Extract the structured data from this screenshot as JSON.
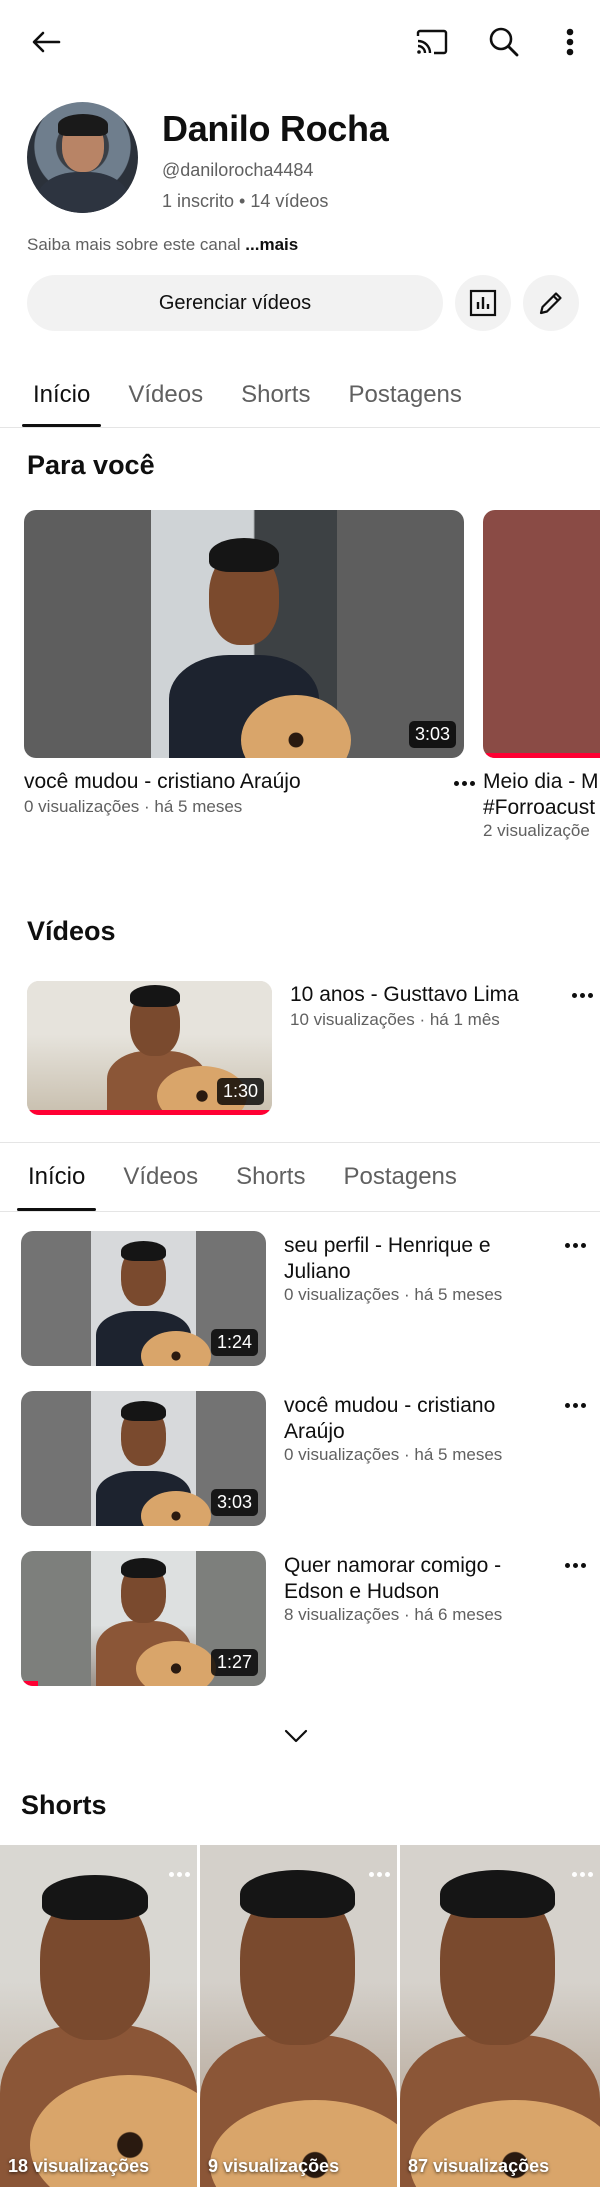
{
  "icons": {
    "back": "back-arrow-icon",
    "cast": "cast-icon",
    "search": "search-icon",
    "more": "more-vert-icon",
    "analytics": "analytics-icon",
    "edit": "pencil-icon",
    "expand": "chevron-down-icon"
  },
  "channel": {
    "name": "Danilo Rocha",
    "handle": "@danilorocha4484",
    "stats": "1 inscrito • 14 vídeos",
    "about_text": "Saiba mais sobre este canal ",
    "about_more": "...mais",
    "manage_label": "Gerenciar vídeos"
  },
  "tabs": [
    "Início",
    "Vídeos",
    "Shorts",
    "Postagens"
  ],
  "for_you": {
    "title": "Para você",
    "items": [
      {
        "title": "você mudou - cristiano Araújo",
        "meta": "0 visualizações · há 5 meses",
        "duration": "3:03"
      },
      {
        "title_line1": "Meio dia - M",
        "title_line2": "#Forroacust",
        "meta": "2 visualizaçõe"
      }
    ]
  },
  "videos_section": {
    "title": "Vídeos",
    "featured": {
      "title": "10 anos - Gusttavo Lima",
      "meta": "10 visualizações · há 1 mês",
      "duration": "1:30",
      "progress": 1.0
    }
  },
  "videos_list": [
    {
      "title_line1": "seu perfil - Henrique e",
      "title_line2": "Juliano",
      "meta": "0 visualizações · há 5 meses",
      "duration": "1:24"
    },
    {
      "title_line1": "você mudou - cristiano",
      "title_line2": "Araújo",
      "meta": "0 visualizações · há 5 meses",
      "duration": "3:03"
    },
    {
      "title_line1": "Quer namorar comigo -",
      "title_line2": "Edson e Hudson",
      "meta": "8 visualizações · há 6 meses",
      "duration": "1:27",
      "progress": 0.07
    }
  ],
  "shorts": {
    "title": "Shorts",
    "items": [
      {
        "views": "18 visualizações"
      },
      {
        "views": "9 visualizações"
      },
      {
        "views": "87 visualizações"
      }
    ]
  },
  "colors": {
    "progress": "#ff0033",
    "chip_bg": "#f2f2f2",
    "secondary_text": "#606060"
  }
}
